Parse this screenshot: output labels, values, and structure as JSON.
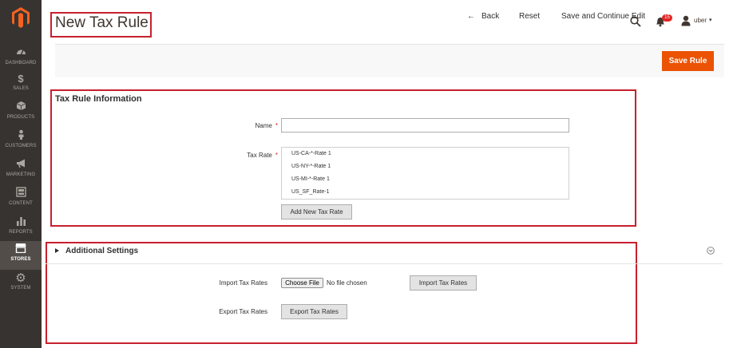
{
  "sidebar": {
    "items": [
      {
        "label": "DASHBOARD",
        "icon": "dashboard-icon"
      },
      {
        "label": "SALES",
        "icon": "dollar-icon"
      },
      {
        "label": "PRODUCTS",
        "icon": "cube-icon"
      },
      {
        "label": "CUSTOMERS",
        "icon": "person-icon"
      },
      {
        "label": "MARKETING",
        "icon": "megaphone-icon"
      },
      {
        "label": "CONTENT",
        "icon": "layout-icon"
      },
      {
        "label": "REPORTS",
        "icon": "bar-chart-icon"
      },
      {
        "label": "STORES",
        "icon": "store-icon",
        "active": true
      },
      {
        "label": "SYSTEM",
        "icon": "gear-icon"
      }
    ]
  },
  "header": {
    "title": "New Tax Rule",
    "notification_count": "15",
    "user": "uber"
  },
  "actions": {
    "back": "Back",
    "reset": "Reset",
    "save_continue": "Save and Continue Edit",
    "save": "Save Rule"
  },
  "tax_rule": {
    "section_title": "Tax Rule Information",
    "name_label": "Name",
    "name_value": "",
    "tax_rate_label": "Tax Rate",
    "tax_rates": [
      "US-CA-*-Rate 1",
      "US-NY-*-Rate 1",
      "US-MI-*-Rate 1",
      "US_SF_Rate-1"
    ],
    "add_rate_button": "Add New Tax Rate"
  },
  "additional": {
    "title": "Additional Settings",
    "import_label": "Import Tax Rates",
    "choose_file": "Choose File",
    "no_file": "No file chosen",
    "import_button": "Import Tax Rates",
    "export_label": "Export Tax Rates",
    "export_button": "Export Tax Rates"
  },
  "colors": {
    "sidebar_bg": "#373330",
    "accent": "#eb5202",
    "highlight_box": "#c8202e"
  }
}
